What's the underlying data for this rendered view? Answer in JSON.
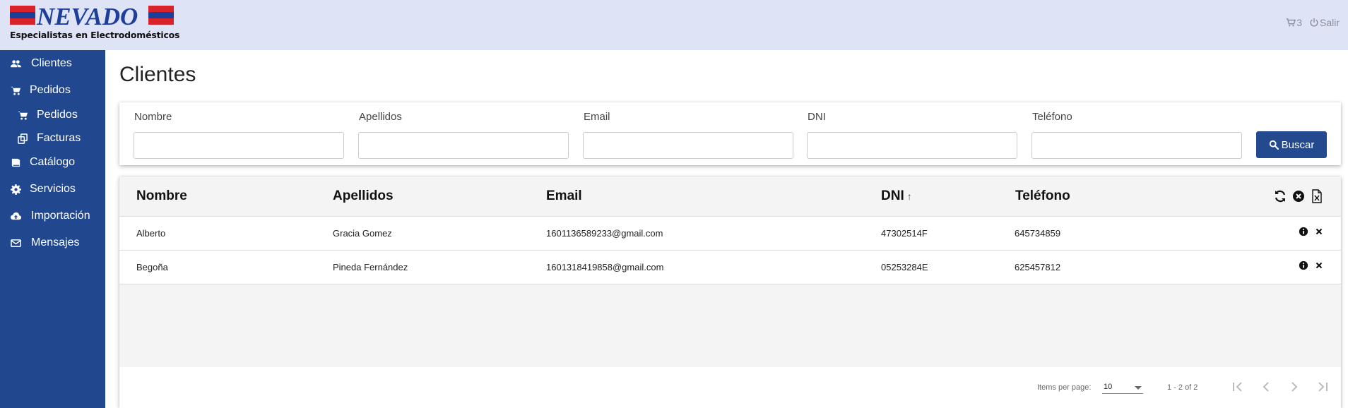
{
  "app": {
    "logo": {
      "wordmark": "NEVADO",
      "tagline": "Especialistas en Electrodomésticos"
    },
    "header": {
      "cart_count": "3",
      "logout_label": "Salir"
    }
  },
  "sidebar": {
    "items": [
      {
        "label": "Clientes",
        "icon": "users-icon"
      },
      {
        "label": "Pedidos",
        "icon": "cart-icon"
      },
      {
        "label": "Pedidos",
        "icon": "cart-icon",
        "sub": true
      },
      {
        "label": "Facturas",
        "icon": "copy-icon",
        "sub": true
      },
      {
        "label": "Catálogo",
        "icon": "book-icon"
      },
      {
        "label": "Servicios",
        "icon": "gear-icon"
      },
      {
        "label": "Importación",
        "icon": "cloud-upload-icon"
      },
      {
        "label": "Mensajes",
        "icon": "envelope-icon"
      }
    ]
  },
  "page": {
    "title": "Clientes"
  },
  "filters": {
    "fields": [
      {
        "label": "Nombre",
        "value": ""
      },
      {
        "label": "Apellidos",
        "value": ""
      },
      {
        "label": "Email",
        "value": ""
      },
      {
        "label": "DNI",
        "value": ""
      },
      {
        "label": "Teléfono",
        "value": ""
      }
    ],
    "search_label": "Buscar"
  },
  "table": {
    "columns": [
      "Nombre",
      "Apellidos",
      "Email",
      "DNI",
      "Teléfono"
    ],
    "sort_column": "DNI",
    "sort_arrow": "↑",
    "rows": [
      {
        "nombre": "Alberto",
        "apellidos": "Gracia Gomez",
        "email": "1601136589233@gmail.com",
        "dni": "47302514F",
        "telefono": "645734859"
      },
      {
        "nombre": "Begoña",
        "apellidos": "Pineda Fernández",
        "email": "1601318419858@gmail.com",
        "dni": "05253284E",
        "telefono": "625457812"
      }
    ]
  },
  "paginator": {
    "items_per_page_label": "Items per page:",
    "items_per_page": "10",
    "range": "1 - 2 of 2"
  },
  "colors": {
    "sidebar": "#21488f",
    "header": "#dfe3f6",
    "accent": "#23498f"
  }
}
